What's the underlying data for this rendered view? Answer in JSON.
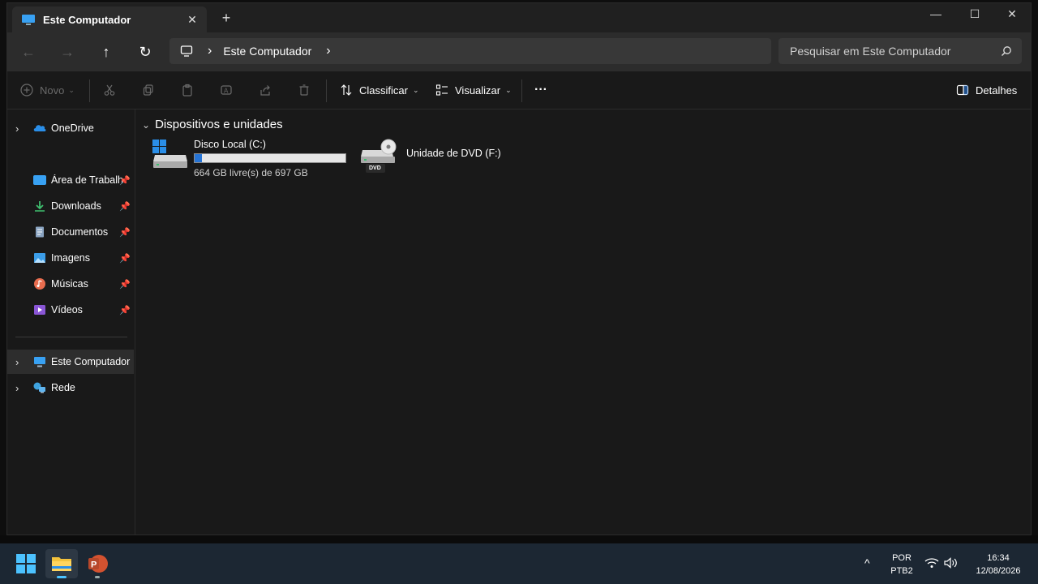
{
  "window": {
    "tab_title": "Este Computador",
    "tab_close": "✕",
    "new_tab": "+",
    "minimize": "—",
    "maximize": "☐",
    "close": "✕"
  },
  "nav": {
    "back": "←",
    "forward": "→",
    "up": "↑",
    "refresh": "↻",
    "breadcrumb_sep": "›",
    "breadcrumb": "Este Computador",
    "search_placeholder": "Pesquisar em Este Computador"
  },
  "commands": {
    "new_label": "Novo",
    "sort_label": "Classificar",
    "view_label": "Visualizar",
    "more": "···",
    "details_label": "Detalhes"
  },
  "sidebar": {
    "items": [
      {
        "label": "OneDrive"
      },
      {
        "label": "Área de Trabalho"
      },
      {
        "label": "Downloads"
      },
      {
        "label": "Documentos"
      },
      {
        "label": "Imagens"
      },
      {
        "label": "Músicas"
      },
      {
        "label": "Vídeos"
      },
      {
        "label": "Este Computador"
      },
      {
        "label": "Rede"
      }
    ]
  },
  "content": {
    "group_title": "Dispositivos e unidades",
    "drives": [
      {
        "name": "Disco Local (C:)",
        "free_text": "664 GB livre(s) de 697 GB",
        "used_fraction": 0.047
      },
      {
        "name": "Unidade de DVD (F:)",
        "badge": "DVD"
      }
    ]
  },
  "taskbar": {
    "lang_top": "POR",
    "lang_bottom": "PTB2",
    "time": "16:34",
    "date": "12/08/2026",
    "chevron": "^"
  },
  "colors": {
    "accent": "#2674d6",
    "onedrive": "#2a8ee8",
    "desktop": "#38a1f3",
    "downloads": "#3fbf6f",
    "music": "#e86c4e",
    "videos": "#8a56d6"
  }
}
